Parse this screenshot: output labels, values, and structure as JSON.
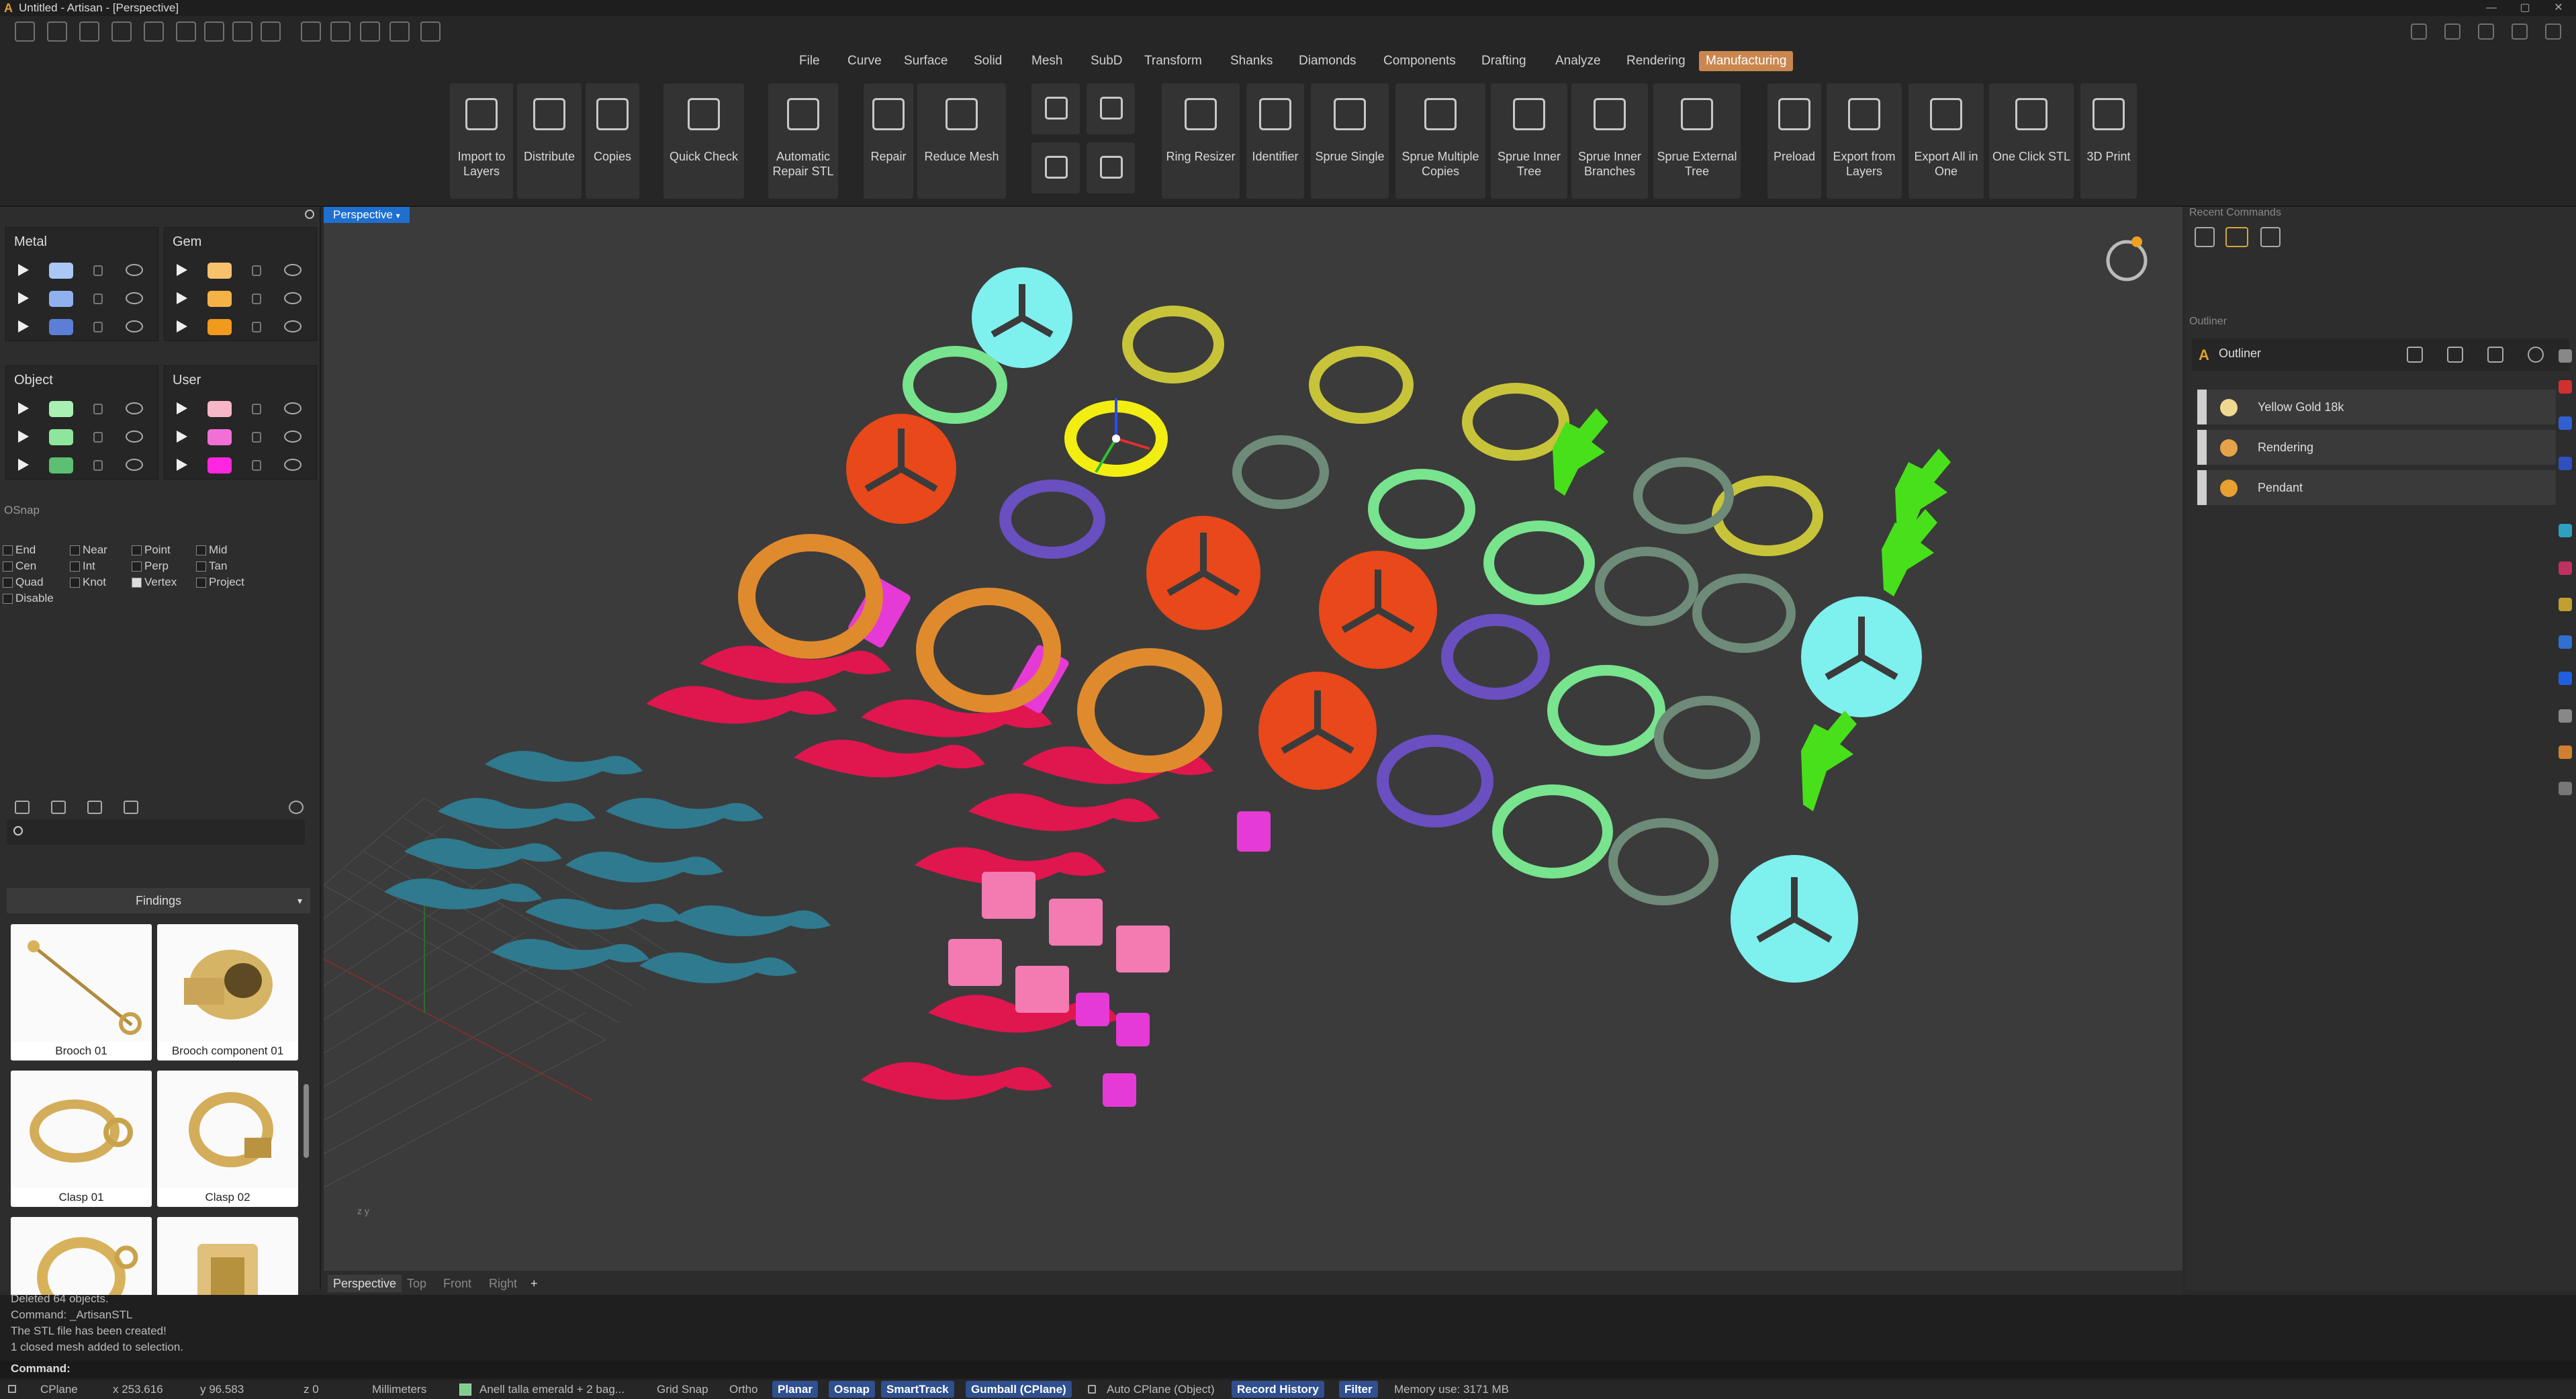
{
  "titlebar": {
    "title": "Untitled - Artisan - [Perspective]"
  },
  "menu": [
    "File",
    "Curve",
    "Surface",
    "Solid",
    "Mesh",
    "SubD",
    "Transform",
    "Shanks",
    "Diamonds",
    "Components",
    "Drafting",
    "Analyze",
    "Rendering",
    "Manufacturing"
  ],
  "ribbon": [
    {
      "l1": "Import to",
      "l2": "Layers"
    },
    {
      "l1": "Distribute",
      "l2": ""
    },
    {
      "l1": "Copies",
      "l2": ""
    },
    {
      "l1": "Quick Check",
      "l2": ""
    },
    {
      "l1": "Automatic",
      "l2": "Repair STL"
    },
    {
      "l1": "Repair",
      "l2": ""
    },
    {
      "l1": "Reduce Mesh",
      "l2": ""
    },
    {
      "l1": "Ring Resizer",
      "l2": ""
    },
    {
      "l1": "Identifier",
      "l2": ""
    },
    {
      "l1": "Sprue Single",
      "l2": ""
    },
    {
      "l1": "Sprue Multiple",
      "l2": "Copies"
    },
    {
      "l1": "Sprue Inner",
      "l2": "Tree"
    },
    {
      "l1": "Sprue Inner",
      "l2": "Branches"
    },
    {
      "l1": "Sprue External",
      "l2": "Tree"
    },
    {
      "l1": "Preload",
      "l2": ""
    },
    {
      "l1": "Export from",
      "l2": "Layers"
    },
    {
      "l1": "Export All in",
      "l2": "One"
    },
    {
      "l1": "One Click STL",
      "l2": ""
    },
    {
      "l1": "3D Print",
      "l2": ""
    }
  ],
  "layers": {
    "metal": {
      "title": "Metal",
      "colors": [
        "#a9c8f5",
        "#8fb1ee",
        "#5b7fd6"
      ]
    },
    "gem": {
      "title": "Gem",
      "colors": [
        "#f7c26b",
        "#f5b347",
        "#f29a1d"
      ]
    },
    "object": {
      "title": "Object",
      "colors": [
        "#a9f0b3",
        "#8fe59c",
        "#5cbf72"
      ]
    },
    "user": {
      "title": "User",
      "colors": [
        "#f7b7c9",
        "#f070d6",
        "#ff26e0"
      ]
    }
  },
  "osnap": {
    "title": "OSnap",
    "items": [
      "End",
      "Near",
      "Point",
      "Mid",
      "Cen",
      "Int",
      "Perp",
      "Tan",
      "Quad",
      "Knot",
      "Vertex",
      "Project",
      "Disable"
    ]
  },
  "library": {
    "dropdown": "Findings",
    "items": [
      "Brooch 01",
      "Brooch component 01",
      "Clasp 01",
      "Clasp 02"
    ]
  },
  "viewport": {
    "title": "Perspective",
    "tabs": [
      "Perspective",
      "Top",
      "Front",
      "Right",
      "+"
    ]
  },
  "right": {
    "recent": "Recent Commands",
    "outliner_hdr": "Outliner",
    "outliner": "Outliner",
    "items": [
      {
        "name": "Yellow Gold 18k",
        "color": "#f0d890"
      },
      {
        "name": "Rendering",
        "color": "#e8a24a"
      },
      {
        "name": "Pendant",
        "color": "#e8a030"
      }
    ]
  },
  "command": {
    "lines": [
      "Deleted 64 objects.",
      "Command: _ArtisanSTL",
      "The STL file has been created!",
      "1 closed mesh added to selection."
    ],
    "prompt": "Command:"
  },
  "status": [
    "CPlane",
    "x 253.616",
    "y 96.583",
    "z 0",
    "Millimeters",
    "Anell talla emerald + 2 bag...",
    "Grid Snap",
    "Ortho",
    "Planar",
    "Osnap",
    "SmartTrack",
    "Gumball (CPlane)",
    "Auto CPlane (Object)",
    "Record History",
    "Filter",
    "Memory use: 3171 MB"
  ]
}
